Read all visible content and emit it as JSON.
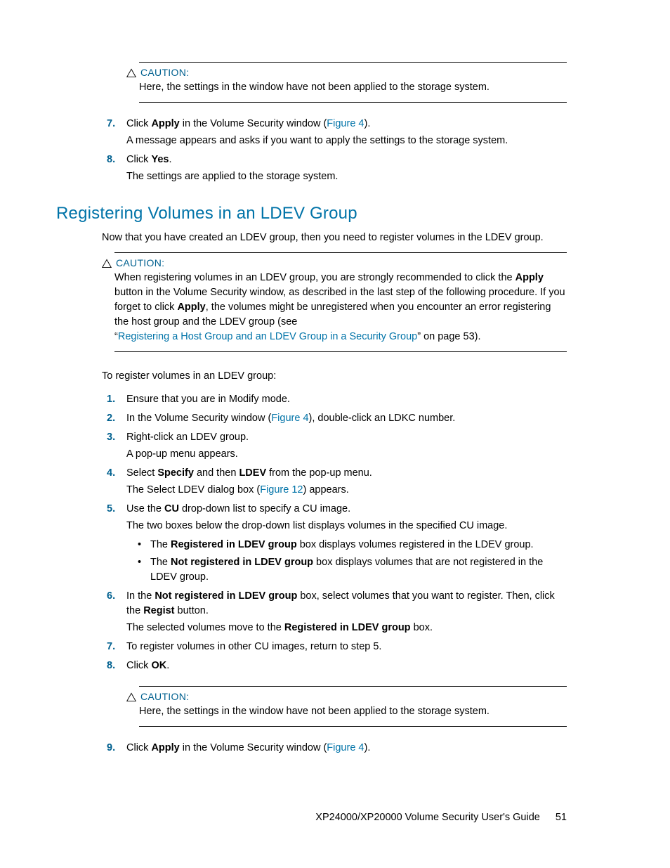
{
  "caution1": {
    "label": "CAUTION:",
    "body": "Here, the settings in the window have not been applied to the storage system."
  },
  "topsteps": {
    "s7_num": "7.",
    "s7_a": "Click ",
    "s7_b": "Apply",
    "s7_c": " in the Volume Security window (",
    "s7_link": "Figure 4",
    "s7_d": ").",
    "s7_body": "A message appears and asks if you want to apply the settings to the storage system.",
    "s8_num": "8.",
    "s8_a": "Click ",
    "s8_b": "Yes",
    "s8_c": ".",
    "s8_body": "The settings are applied to the storage system."
  },
  "section_title": "Registering Volumes in an LDEV Group",
  "section_intro": "Now that you have created an LDEV group, then you need to register volumes in the LDEV group.",
  "caution2": {
    "label": "CAUTION:",
    "p1a": "When registering volumes in an LDEV group, you are strongly recommended to click the ",
    "p1b": "Apply",
    "p1c": " button in the Volume Security window, as described in the last step of the following procedure. If you forget to click ",
    "p1d": "Apply",
    "p1e": ", the volumes might be unregistered when you encounter an error registering the host group and the LDEV group (see",
    "p2a": "“",
    "p2link": "Registering a Host Group and an LDEV Group in a Security Group",
    "p2b": "” on page 53)."
  },
  "leadline": "To register volumes in an LDEV group:",
  "steps": {
    "s1_num": "1.",
    "s1": "Ensure that you are in Modify mode.",
    "s2_num": "2.",
    "s2a": "In the Volume Security window (",
    "s2link": "Figure 4",
    "s2b": "), double-click an LDKC number.",
    "s3_num": "3.",
    "s3": "Right-click an LDEV group.",
    "s3_body": "A pop-up menu appears.",
    "s4_num": "4.",
    "s4a": "Select ",
    "s4b": "Specify",
    "s4c": " and then ",
    "s4d": "LDEV",
    "s4e": " from the pop-up menu.",
    "s4_body_a": "The Select LDEV dialog box (",
    "s4_body_link": "Figure 12",
    "s4_body_b": ") appears.",
    "s5_num": "5.",
    "s5a": "Use the ",
    "s5b": "CU",
    "s5c": " drop-down list to specify a CU image.",
    "s5_body": "The two boxes below the drop-down list displays volumes in the specified CU image.",
    "s5_b1a": "The ",
    "s5_b1b": "Registered in LDEV group",
    "s5_b1c": " box displays volumes registered in the LDEV group.",
    "s5_b2a": "The ",
    "s5_b2b": "Not registered in LDEV group",
    "s5_b2c": " box displays volumes that are not registered in the LDEV group.",
    "s6_num": "6.",
    "s6a": "In the ",
    "s6b": "Not registered in LDEV group",
    "s6c": " box, select volumes that you want to register. Then, click the ",
    "s6d": "Regist",
    "s6e": " button.",
    "s6_body_a": "The selected volumes move to the ",
    "s6_body_b": "Registered in LDEV group",
    "s6_body_c": " box.",
    "s7_num": "7.",
    "s7": "To register volumes in other CU images, return to step 5.",
    "s8_num": "8.",
    "s8a": "Click ",
    "s8b": "OK",
    "s8c": "."
  },
  "caution3": {
    "label": "CAUTION:",
    "body": "Here, the settings in the window have not been applied to the storage system."
  },
  "step9": {
    "num": "9.",
    "a": "Click ",
    "b": "Apply",
    "c": " in the Volume Security window (",
    "link": "Figure 4",
    "d": ")."
  },
  "footer": {
    "title": "XP24000/XP20000 Volume Security User's Guide",
    "page": "51"
  }
}
